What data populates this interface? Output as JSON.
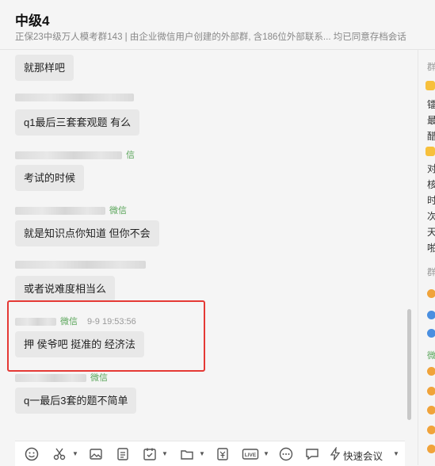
{
  "header": {
    "title": "中级4",
    "subtitle": "正保23中级万人模考群143 | 由企业微信用户创建的外部群, 含186位外部联系... 均已同意存档会话"
  },
  "messages": [
    {
      "text": "就那样吧"
    },
    {
      "text": "q1最后三套套观题 有么"
    },
    {
      "sender_tag": "信",
      "text": "考试的时候"
    },
    {
      "sender_tag": "微信",
      "text": "就是知识点你知道 但你不会"
    },
    {
      "text": "或者说难度相当么"
    },
    {
      "sender_tag": "微信",
      "time": "9-9 19:53:56",
      "text": "押 侯爷吧 挺准的 经济法"
    },
    {
      "sender_tag": "微信",
      "text": "q一最后3套的题不简单"
    }
  ],
  "right_panel": {
    "section1_label": "群",
    "chars": [
      "镭",
      "最",
      "醋",
      "对",
      "核",
      "时",
      "次",
      "天",
      "啪"
    ],
    "section2_label": "群",
    "section3_label": "微"
  },
  "toolbar": {
    "emoji_icon": "emoji-icon",
    "meeting_label": "快速会议",
    "live_label": "LIVE"
  },
  "colors": {
    "highlight": "#e53935",
    "wechat_tag": "#5aa55a",
    "bubble": "#e8e8e8"
  }
}
